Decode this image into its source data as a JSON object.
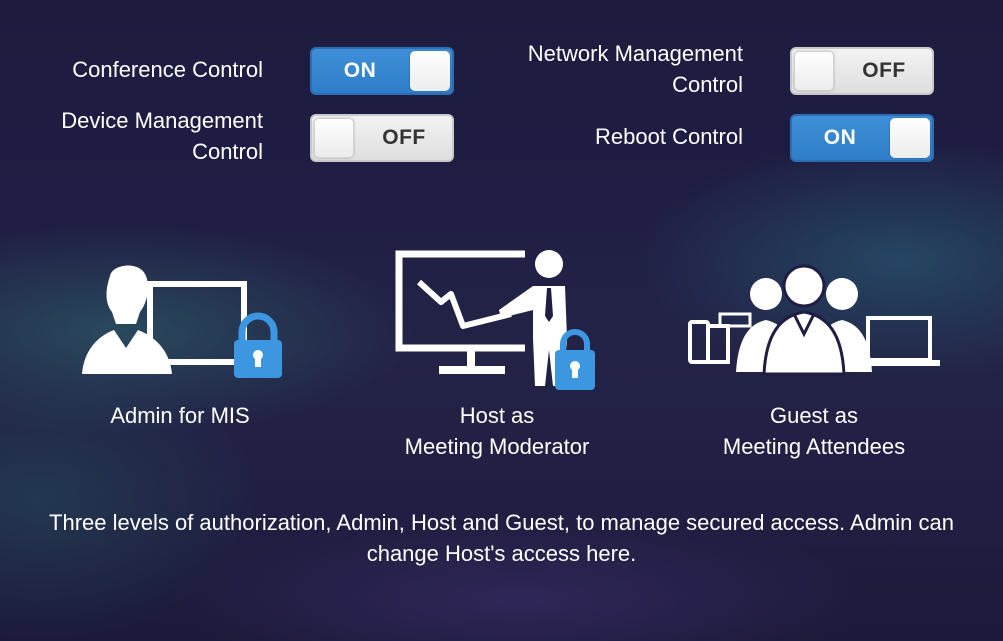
{
  "controls": [
    {
      "id": "conference",
      "label_lines": [
        "Conference Control"
      ],
      "state": "ON"
    },
    {
      "id": "device",
      "label_lines": [
        "Device Management",
        "Control"
      ],
      "state": "OFF"
    },
    {
      "id": "network",
      "label_lines": [
        "Network Management",
        "Control"
      ],
      "state": "OFF"
    },
    {
      "id": "reboot",
      "label_lines": [
        "Reboot Control"
      ],
      "state": "ON"
    }
  ],
  "roles": [
    {
      "id": "admin",
      "icon": "admin-lock-icon",
      "lines": [
        "Admin for MIS"
      ]
    },
    {
      "id": "host",
      "icon": "presenter-lock-icon",
      "lines": [
        "Host as",
        "Meeting Moderator"
      ]
    },
    {
      "id": "guest",
      "icon": "attendees-group-icon",
      "lines": [
        "Guest as",
        "Meeting Attendees"
      ]
    }
  ],
  "description": "Three levels of authorization, Admin, Host and Guest, to manage secured access. Admin can change Host's access here.",
  "colors": {
    "toggle_on": "#3a88d2",
    "toggle_off": "#e9e9e9",
    "lock_blue": "#3d97e0",
    "background": "#1f1d43"
  }
}
